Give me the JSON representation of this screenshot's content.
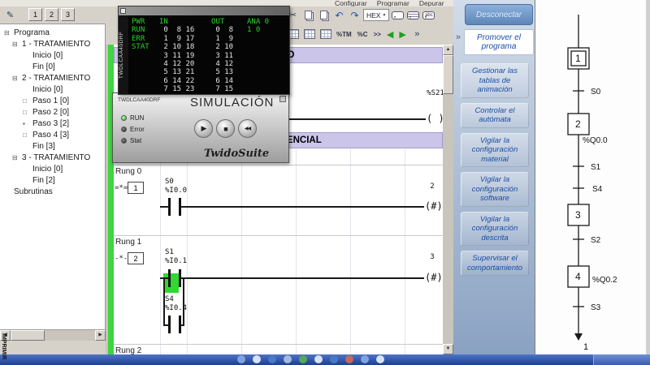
{
  "menubar": {
    "items": [
      "Configurar",
      "Programar",
      "Depurar"
    ]
  },
  "toolbar": {
    "hex_label": "HEX",
    "abc_label": "abc",
    "tm_label": "%TM",
    "c_label": "%C",
    "shift_label": ">>",
    "more_label": "»"
  },
  "left_toolbar": {
    "view_buttons": [
      "1",
      "2",
      "3"
    ]
  },
  "tree": {
    "items": [
      {
        "cls": "ind0",
        "marker": "⊟",
        "label": "Programa"
      },
      {
        "cls": "ind1",
        "marker": "⊟",
        "label": "1 - TRATAMIENTO"
      },
      {
        "cls": "ind2",
        "marker": "",
        "label": "Inicio [0]"
      },
      {
        "cls": "ind2",
        "marker": "",
        "label": "Fin [0]"
      },
      {
        "cls": "ind1",
        "marker": "⊟",
        "label": "2 - TRATAMIENTO"
      },
      {
        "cls": "ind2",
        "marker": "",
        "label": "Inicio [0]"
      },
      {
        "cls": "ind2",
        "marker": "□",
        "label": "Paso 1 [0]"
      },
      {
        "cls": "ind2",
        "marker": "□",
        "label": "Paso 2 [0]"
      },
      {
        "cls": "ind2",
        "marker": "▪",
        "label": "Paso 3 [2]"
      },
      {
        "cls": "ind2",
        "marker": "□",
        "label": "Paso 4 [3]"
      },
      {
        "cls": "ind2",
        "marker": "",
        "label": "Fin [3]"
      },
      {
        "cls": "ind1",
        "marker": "⊟",
        "label": "3 - TRATAMIENTO"
      },
      {
        "cls": "ind2",
        "marker": "",
        "label": "Inicio [0]"
      },
      {
        "cls": "ind2",
        "marker": "",
        "label": "Fin [2]"
      },
      {
        "cls": "ind0",
        "marker": "",
        "label": "Subrutinas"
      }
    ]
  },
  "monitor": {
    "device": "TWDLCAA40DRF",
    "rows": [
      {
        "cls": "hdr",
        "label": "PWR",
        "in": "IN",
        "out": "OUT",
        "ana": "ANA 0"
      },
      {
        "cls": "",
        "label": "RUN",
        "in": " 0  8 16",
        "out": " 0  8",
        "ana": "1 0"
      },
      {
        "cls": "",
        "label": "ERR",
        "in": " 1  9 17",
        "out": " 1  9",
        "ana": ""
      },
      {
        "cls": "",
        "label": "STAT",
        "in": " 2 10 18",
        "out": " 2 10",
        "ana": ""
      },
      {
        "cls": "",
        "label": "",
        "in": " 3 11 19",
        "out": " 3 11",
        "ana": ""
      },
      {
        "cls": "",
        "label": "",
        "in": " 4 12 20",
        "out": " 4 12",
        "ana": ""
      },
      {
        "cls": "",
        "label": "",
        "in": " 5 13 21",
        "out": " 5 13",
        "ana": ""
      },
      {
        "cls": "",
        "label": "",
        "in": " 6 14 22",
        "out": " 6 14",
        "ana": ""
      },
      {
        "cls": "",
        "label": "",
        "in": " 7 15 23",
        "out": " 7 15",
        "ana": ""
      }
    ]
  },
  "simulator": {
    "device": "TWDLCAA40DRF",
    "title": "SIMULACIÓN",
    "leds": [
      "RUN",
      "Error",
      "Stat"
    ],
    "brand": "TwidoSuite"
  },
  "ladder": {
    "sections": [
      {
        "title": "TRATAMIENTO PREVIO"
      },
      {
        "title": "TRATAMIENTO SECUENCIAL"
      }
    ],
    "s21": {
      "tag": "%S21",
      "coil": "( )"
    },
    "rungs": [
      {
        "name": "Rung 0",
        "op": "=*=",
        "step": "1",
        "c1_tag": "S0",
        "c1_addr": "%I0.0",
        "out_num": "2",
        "coil": "(#)"
      },
      {
        "name": "Rung 1",
        "op": "-*-",
        "step": "2",
        "c1_tag": "S1",
        "c1_addr": "%I0.1",
        "c2_tag": "S4",
        "c2_addr": "%I0.4",
        "out_num": "3",
        "coil": "(#)"
      },
      {
        "name": "Rung 2"
      }
    ]
  },
  "right_panel": {
    "disconnect_label": "Desconectar",
    "primary_label": "Promover el programa",
    "buttons": [
      "Gestionar las tablas de animación",
      "Controlar el autómata",
      "Vigilar la configuración material",
      "Vigilar la configuración software",
      "Vigilar la configuración descrita",
      "Supervisar el comportamiento"
    ]
  },
  "sfc": {
    "steps": [
      {
        "n": "1"
      },
      {
        "n": "2"
      },
      {
        "n": "3"
      },
      {
        "n": "4"
      }
    ],
    "transitions": [
      {
        "n": "S0"
      },
      {
        "n": "S1"
      },
      {
        "n": "S4"
      },
      {
        "n": "S2"
      },
      {
        "n": "S3"
      }
    ],
    "actions": [
      {
        "n": "%Q0.0"
      },
      {
        "n": "%Q0.2"
      }
    ],
    "loop_target": "1"
  },
  "footer": {
    "imprimir": "IMPRIMIR"
  },
  "taskbar": {
    "icons": [
      {
        "color": "#7fa3de"
      },
      {
        "color": "#d9e2f0"
      },
      {
        "color": "#4a79c4"
      },
      {
        "color": "#a6bbdb"
      },
      {
        "color": "#57a857"
      },
      {
        "color": "#d9e2f0"
      },
      {
        "color": "#4a79c4"
      },
      {
        "color": "#c46a5a"
      },
      {
        "color": "#7fa3de"
      },
      {
        "color": "#d9e2f0"
      }
    ]
  },
  "colors": {
    "accent_green": "#3fd43f",
    "section_bar": "#cbc5ea",
    "panel_blue_text": "#1b4ea6",
    "monitor_green": "#28d428"
  }
}
